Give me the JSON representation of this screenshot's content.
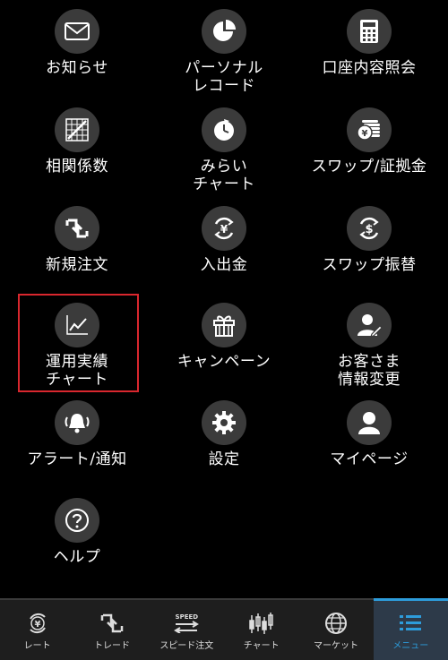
{
  "menu": {
    "items": [
      {
        "label": "お知らせ",
        "icon": "envelope-icon"
      },
      {
        "label": "パーソナル\nレコード",
        "icon": "pie-chart-icon"
      },
      {
        "label": "口座内容照会",
        "icon": "calculator-icon"
      },
      {
        "label": "相関係数",
        "icon": "scatter-chart-icon"
      },
      {
        "label": "みらい\nチャート",
        "icon": "future-clock-icon"
      },
      {
        "label": "スワップ/証拠金",
        "icon": "yen-coins-icon"
      },
      {
        "label": "新規注文",
        "icon": "swap-arrows-icon"
      },
      {
        "label": "入出金",
        "icon": "yen-circle-arrows-icon"
      },
      {
        "label": "スワップ振替",
        "icon": "dollar-circle-arrows-icon"
      },
      {
        "label": "運用実績\nチャート",
        "icon": "line-chart-icon"
      },
      {
        "label": "キャンペーン",
        "icon": "gift-icon"
      },
      {
        "label": "お客さま\n情報変更",
        "icon": "user-edit-icon"
      },
      {
        "label": "アラート/通知",
        "icon": "bell-icon"
      },
      {
        "label": "設定",
        "icon": "gear-icon"
      },
      {
        "label": "マイページ",
        "icon": "user-icon"
      },
      {
        "label": "ヘルプ",
        "icon": "question-icon"
      }
    ]
  },
  "tabbar": {
    "tabs": [
      {
        "label": "レート",
        "icon": "yen-rate-icon"
      },
      {
        "label": "トレード",
        "icon": "trade-arrows-icon"
      },
      {
        "label": "スピード注文",
        "icon": "speed-order-icon"
      },
      {
        "label": "チャート",
        "icon": "candlestick-icon"
      },
      {
        "label": "マーケット",
        "icon": "globe-icon"
      },
      {
        "label": "メニュー",
        "icon": "menu-list-icon"
      }
    ],
    "speed_badge": "SPEED",
    "active_tab": "メニュー",
    "active_color": "#2d9cdb"
  },
  "highlight_color": "#d9272e"
}
